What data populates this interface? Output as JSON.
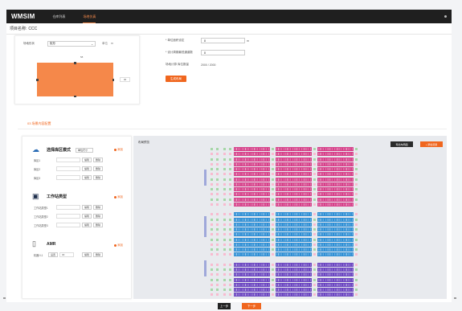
{
  "app": {
    "brand": "WMSIM",
    "nav": [
      "仓库列表",
      "场地仿真"
    ],
    "active_nav": 1
  },
  "project": {
    "label": "项目名称:",
    "name": "CCC"
  },
  "layout_card": {
    "field_label": "场地形状",
    "field_value": "矩形",
    "extra_label": "单位",
    "extra_value": "m",
    "width_value": "58",
    "height_value": "30"
  },
  "size_form": {
    "rows": [
      {
        "label": "* 单位面积设定",
        "value": "8",
        "unit": "m"
      },
      {
        "label": "* 设计周期最低通道数",
        "value": "8",
        "unit": ""
      }
    ],
    "capacity_label": "场地计算 库位数量",
    "capacity_value": "2000 / 2000",
    "calc_button": "生成布局"
  },
  "section": {
    "title": "03 场景内容配置"
  },
  "groups": [
    {
      "icon": "shelf-icon",
      "title": "选择库区模式",
      "select": "单位尺寸",
      "add_label": "添加",
      "items": [
        {
          "name": "库区1",
          "buttons": [
            "编辑",
            "删除"
          ]
        },
        {
          "name": "库区2",
          "buttons": [
            "编辑",
            "删除"
          ]
        },
        {
          "name": "库区3",
          "buttons": [
            "编辑",
            "删除"
          ]
        }
      ]
    },
    {
      "icon": "workstation-icon",
      "title": "工作站类型",
      "select": "",
      "add_label": "添加",
      "items": [
        {
          "name": "工作站类型1",
          "buttons": [
            "编辑",
            "删除"
          ]
        },
        {
          "name": "工作站类型2",
          "buttons": [
            "编辑",
            "删除"
          ]
        },
        {
          "name": "工作站类型3",
          "buttons": [
            "编辑",
            "删除"
          ]
        }
      ]
    },
    {
      "icon": "robot-icon",
      "title": "AMR",
      "select": "",
      "add_label": "添加",
      "items": [
        {
          "name": "机器人1",
          "buttons": [
            "设置",
            "编辑",
            "删除"
          ],
          "value": "30"
        }
      ]
    }
  ],
  "preview": {
    "title": "布局预览",
    "btn_dark": "导出布局图",
    "btn_orange": "+ 添加货架"
  },
  "footer": {
    "btn_prev": "上一步",
    "btn_next": "下一步"
  },
  "colors": {
    "accent": "#f0661e",
    "rack_pink": "#d6418a",
    "rack_blue": "#2f8fd5",
    "rack_purple": "#6b46c1"
  }
}
